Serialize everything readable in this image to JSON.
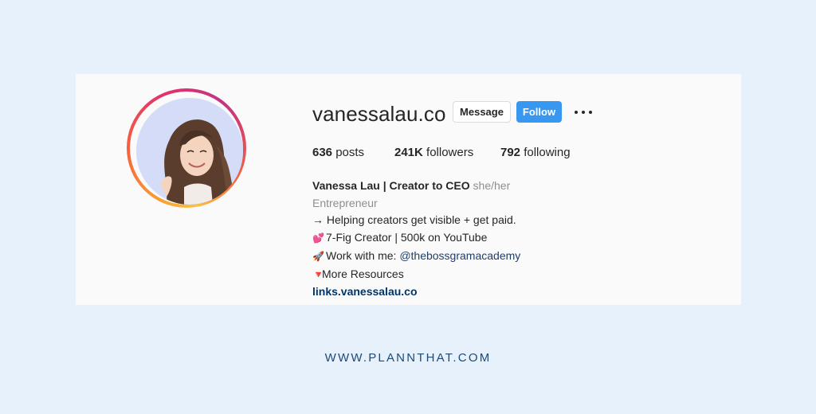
{
  "profile": {
    "username": "vanessalau.co",
    "message_label": "Message",
    "follow_label": "Follow",
    "stats": {
      "posts_count": "636",
      "posts_label": "posts",
      "followers_count": "241K",
      "followers_label": "followers",
      "following_count": "792",
      "following_label": "following"
    },
    "bio": {
      "name": "Vanessa Lau | Creator to CEO",
      "pronouns": "she/her",
      "category": "Entrepreneur",
      "line1": "→ Helping creators get visible + get paid.",
      "line2_icon": "💕",
      "line2": "7-Fig Creator | 500k on YouTube",
      "line3_icon": "🚀",
      "line3_prefix": "Work with me: ",
      "line3_mention": "@thebossgramacademy",
      "line4_icon": "🔻",
      "line4": "More Resources",
      "website": "links.vanessalau.co"
    }
  },
  "footer": {
    "text": "WWW.PLANNTHAT.COM"
  },
  "colors": {
    "page_background": "#e6f1fc",
    "card_background": "#fafafa",
    "follow_button": "#3897f0",
    "footer_text": "#1e4a76"
  },
  "icons": {
    "more": "more-options-icon",
    "line2": "two-hearts-icon",
    "line3": "rocket-icon",
    "line4": "red-triangle-down-icon"
  }
}
